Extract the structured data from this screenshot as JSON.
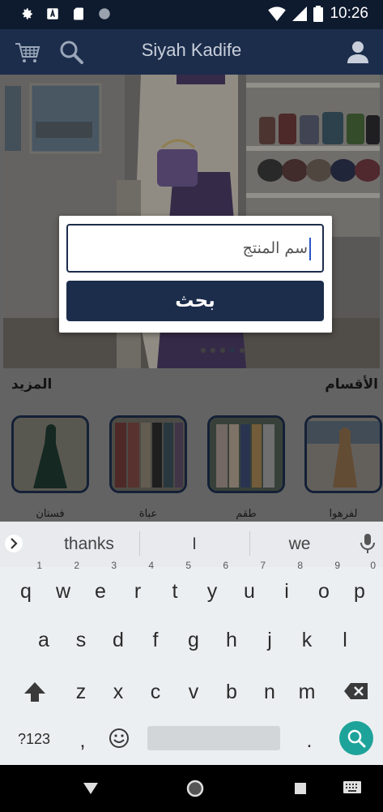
{
  "status_bar": {
    "time": "10:26",
    "icons": [
      "settings-icon",
      "a-notification-icon",
      "sd-card-icon",
      "circle-icon",
      "wifi-icon",
      "signal-icon",
      "battery-icon"
    ]
  },
  "app_bar": {
    "title": "Siyah Kadife",
    "icons": [
      "cart-icon",
      "search-icon",
      "account-icon"
    ]
  },
  "sections": {
    "categories_title": "الأقسام",
    "more_label": "المزيد"
  },
  "categories": [
    {
      "label": "فستان"
    },
    {
      "label": "عباة"
    },
    {
      "label": "طقم"
    },
    {
      "label": "لفرهوا"
    }
  ],
  "dialog": {
    "search_placeholder": "سم المنتج",
    "search_button_label": "بحث"
  },
  "keyboard": {
    "suggestions": [
      "thanks",
      "I",
      "we"
    ],
    "row1": [
      {
        "key": "q",
        "hint": "1"
      },
      {
        "key": "w",
        "hint": "2"
      },
      {
        "key": "e",
        "hint": "3"
      },
      {
        "key": "r",
        "hint": "4"
      },
      {
        "key": "t",
        "hint": "5"
      },
      {
        "key": "y",
        "hint": "6"
      },
      {
        "key": "u",
        "hint": "7"
      },
      {
        "key": "i",
        "hint": "8"
      },
      {
        "key": "o",
        "hint": "9"
      },
      {
        "key": "p",
        "hint": "0"
      }
    ],
    "row2": [
      "a",
      "s",
      "d",
      "f",
      "g",
      "h",
      "j",
      "k",
      "l"
    ],
    "row3": [
      "z",
      "x",
      "c",
      "v",
      "b",
      "n",
      "m"
    ],
    "symbols_label": "?123",
    "comma_label": ",",
    "period_label": "."
  },
  "colors": {
    "app_bar": "#1c2d4c",
    "accent": "#1ea39a",
    "caret": "#2a56c6"
  }
}
